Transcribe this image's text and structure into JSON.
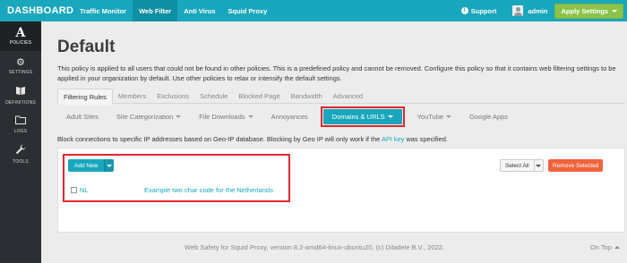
{
  "topbar": {
    "brand": "DASHBOARD",
    "tabs": [
      {
        "label": "Traffic Monitor"
      },
      {
        "label": "Web Filter"
      },
      {
        "label": "Anti Virus"
      },
      {
        "label": "Squid Proxy"
      }
    ],
    "support_label": "Support",
    "user_label": "admin",
    "apply_label": "Apply Settings"
  },
  "sidebar": {
    "items": [
      {
        "label": "POLICIES",
        "icon": "A"
      },
      {
        "label": "SETTINGS",
        "icon": "gear-icon"
      },
      {
        "label": "DEFINITIONS",
        "icon": "book-icon"
      },
      {
        "label": "LOGS",
        "icon": "folder-icon"
      },
      {
        "label": "TOOLS",
        "icon": "wrench-icon"
      }
    ]
  },
  "page": {
    "title": "Default",
    "description": "This policy is applied to all users that could not be found in other policies. This is a predefined policy and cannot be removed. Configure this policy so that it contains web filtering settings to be applied in your organization by default. Use other policies to relax or intensify the default settings."
  },
  "tabs_primary": [
    {
      "label": "Filtering Rules"
    },
    {
      "label": "Members"
    },
    {
      "label": "Exclusions"
    },
    {
      "label": "Schedule"
    },
    {
      "label": "Blocked Page"
    },
    {
      "label": "Bandwidth"
    },
    {
      "label": "Advanced"
    }
  ],
  "tabs_secondary": [
    {
      "label": "Adult Sites"
    },
    {
      "label": "Site Categorization"
    },
    {
      "label": "File Downloads"
    },
    {
      "label": "Annoyances"
    },
    {
      "label": "Domains & URLS"
    },
    {
      "label": "YouTube"
    },
    {
      "label": "Google Apps"
    }
  ],
  "info": {
    "text": "Block connections to specific IP addresses based on Geo-IP database. Blocking by Geo IP will only work if the ",
    "link": "API key",
    "suffix": " was specified."
  },
  "panel": {
    "add_new_label": "Add New",
    "select_all_label": "Select All",
    "remove_label": "Remove Selected",
    "rows": [
      {
        "code": "NL",
        "comment": "Example two char code for the Netherlands"
      }
    ]
  },
  "footer": {
    "text": "Web Safety for Squid Proxy, version 8.2-amd64-linux-ubuntu20, (c) Diladele B.V., 2022.",
    "on_top": "On Top"
  },
  "colors": {
    "accent": "#19a7bd",
    "apply_green": "#8bc34a",
    "remove_orange": "#f0643c",
    "highlight_red": "#e0282e",
    "sidebar": "#2b2f33"
  }
}
